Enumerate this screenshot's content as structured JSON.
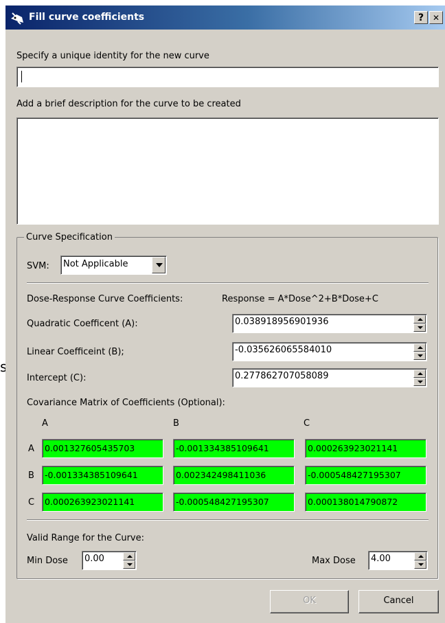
{
  "window": {
    "title": "Fill curve coefficients",
    "help_glyph": "?",
    "close_glyph": "✕",
    "icon": "curve-app-icon"
  },
  "identity": {
    "label": "Specify a unique identity for the new curve",
    "value": ""
  },
  "description": {
    "label": "Add a brief description for the curve to be created",
    "value": ""
  },
  "spec": {
    "group_title": "Curve Specification",
    "svm_label": "SVM:",
    "svm_value": "Not Applicable",
    "coeff_header": "Dose-Response Curve Coefficients:",
    "formula": "Response = A*Dose^2+B*Dose+C",
    "quadratic_label": "Quadratic Coefficent (A):",
    "quadratic_value": "0.038918956901936",
    "linear_label": "Linear Coefficeint (B);",
    "linear_value": "-0.035626065584010",
    "intercept_label": "Intercept (C):",
    "intercept_value": "0.277862707058089",
    "covariance_label": "Covariance Matrix of Coefficients (Optional):",
    "columns": [
      "A",
      "B",
      "C"
    ],
    "rows": [
      {
        "label": "A",
        "cells": [
          "0.001327605435703",
          "-0.001334385109641",
          "0.000263923021141"
        ]
      },
      {
        "label": "B",
        "cells": [
          "-0.001334385109641",
          "0.002342498411036",
          "-0.000548427195307"
        ]
      },
      {
        "label": "C",
        "cells": [
          "0.000263923021141",
          "-0.000548427195307",
          "0.000138014790872"
        ]
      }
    ],
    "cell_color": "#00ff00",
    "range_label": "Valid Range for the Curve:",
    "min_dose_label": "Min Dose",
    "min_dose_value": "0.00",
    "max_dose_label": "Max Dose",
    "max_dose_value": "4.00"
  },
  "buttons": {
    "ok": "OK",
    "cancel": "Cancel"
  },
  "outside_text": "s"
}
